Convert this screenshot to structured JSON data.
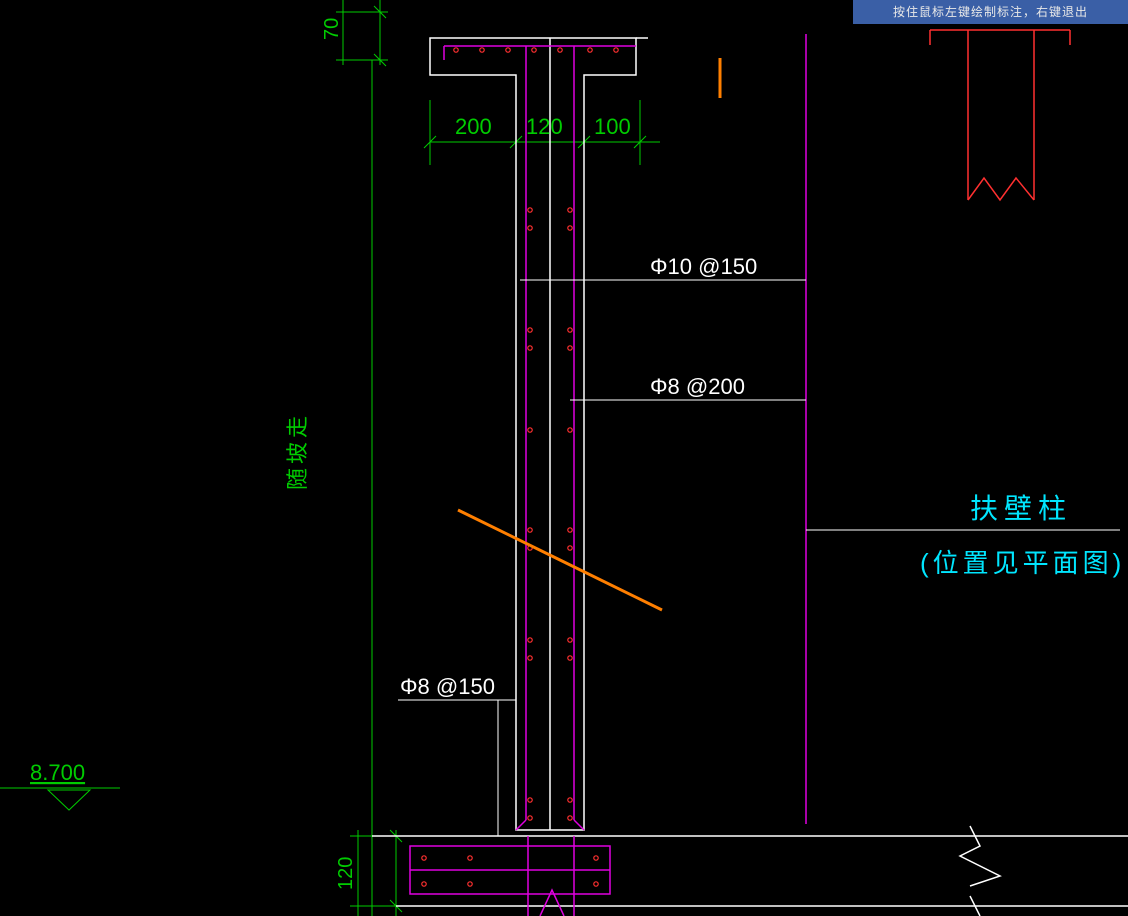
{
  "status_bar": "按住鼠标左键绘制标注，右键退出",
  "dims": {
    "top70": "70",
    "d200": "200",
    "d120": "120",
    "d100": "100",
    "bottom120": "120"
  },
  "elevation": "8.700",
  "vertical_label": "随坡走",
  "rebar": {
    "phi10_150": "Φ10 @150",
    "phi8_200": "Φ8 @200",
    "phi8_150": "Φ8 @150"
  },
  "callout": {
    "title": "扶壁柱",
    "sub": "(位置见平面图)"
  },
  "colors": {
    "green": "#00cc00",
    "white": "#ffffff",
    "magenta": "#e000e0",
    "red": "#ff3030",
    "orange": "#ff7f00",
    "cyan": "#00e6ff"
  }
}
